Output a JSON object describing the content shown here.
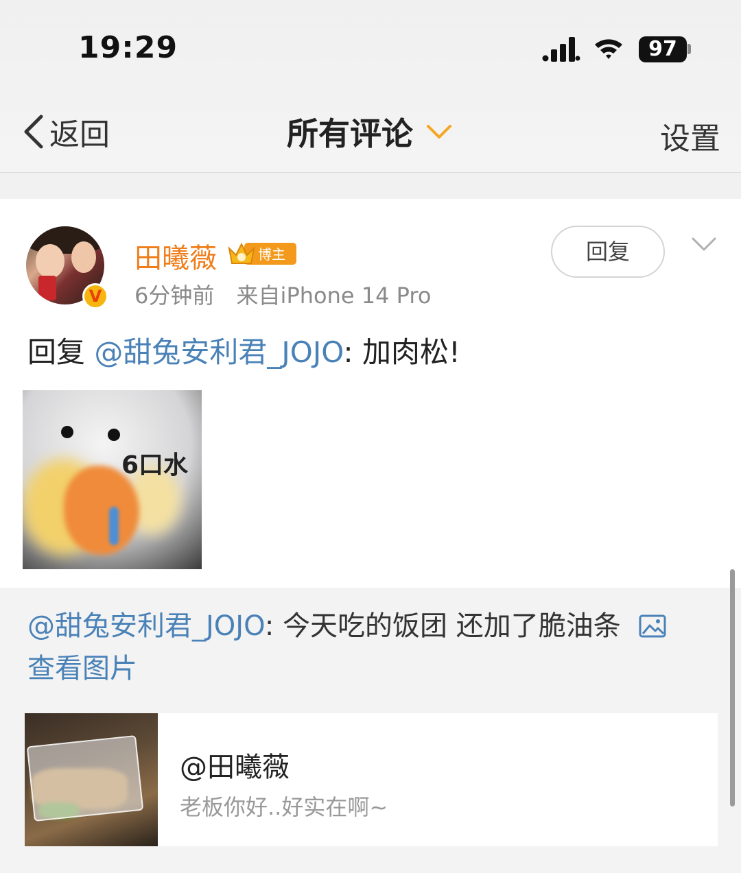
{
  "status_bar": {
    "time": "19:29",
    "battery": "97",
    "signal_icon": "cellular-signal-icon",
    "wifi_icon": "wifi-icon"
  },
  "nav": {
    "back_label": "返回",
    "title": "所有评论",
    "settings_label": "设置",
    "accent_color": "#f5a623"
  },
  "comment": {
    "username": "田曦薇",
    "username_color": "#ef7d1a",
    "badge_label": "博主",
    "verified_mark": "V",
    "time": "6分钟前",
    "source": "来自iPhone 14 Pro",
    "reply_button": "回复",
    "text_prefix": "回复",
    "mention": "@甜兔安利君_JOJO",
    "text_body": ": 加肉松!",
    "sticker_caption": "6口水"
  },
  "original_post": {
    "mention": "@甜兔安利君_JOJO",
    "text": ": 今天吃的饭团 还加了脆油条",
    "view_image_label": "查看图片",
    "card_title": "@田曦薇",
    "card_subtitle": "老板你好..好实在啊~"
  },
  "colors": {
    "link_blue": "#4a82b8",
    "meta_gray": "#8a8a8a"
  }
}
